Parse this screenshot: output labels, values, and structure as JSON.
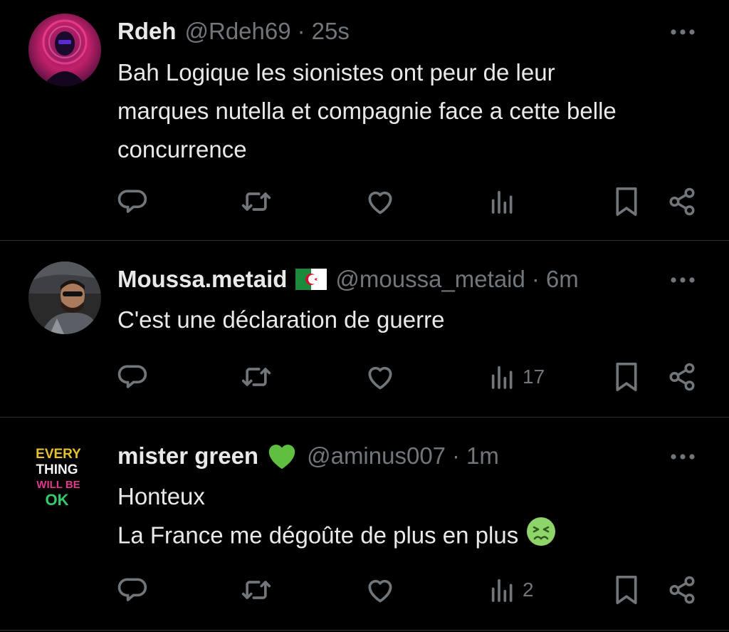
{
  "tweets": [
    {
      "name": "Rdeh",
      "handle": "@Rdeh69",
      "separator": "·",
      "time": "25s",
      "lines": [
        "Bah Logique les sionistes ont peur de leur",
        "marques nutella et compagnie face a cette belle",
        "concurrence"
      ],
      "views": ""
    },
    {
      "name": "Moussa.metaid",
      "name_badge": "algeria-flag-icon",
      "handle": "@moussa_metaid",
      "separator": "·",
      "time": "6m",
      "lines": [
        "C'est une déclaration de guerre"
      ],
      "views": "17"
    },
    {
      "name": "mister green",
      "name_badge": "green-heart-icon",
      "handle": "@aminus007",
      "separator": "·",
      "time": "1m",
      "lines": [
        "Honteux",
        "La France me dégoûte de plus en plus"
      ],
      "line_emoji": "nauseated-face-icon",
      "avatar_text": [
        "EVERY",
        "THING",
        "WILL BE",
        "OK"
      ],
      "views": "2"
    }
  ],
  "theme": {
    "background": "#000000",
    "text": "#e7e9ea",
    "muted": "#71767b",
    "divider": "#2f3336",
    "green_heart": "#5fbf3f"
  }
}
